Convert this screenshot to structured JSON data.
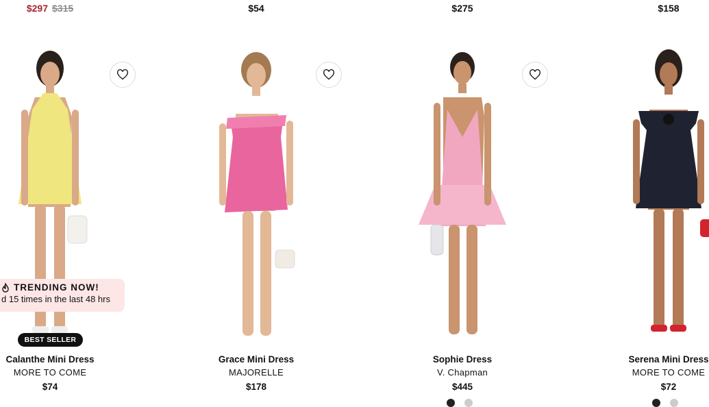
{
  "previous_row": {
    "prices": [
      {
        "sale": "$297",
        "original": "$315"
      },
      {
        "price": "$54"
      },
      {
        "price": "$275"
      },
      {
        "price": "$158"
      }
    ]
  },
  "products": [
    {
      "name": "Calanthe Mini Dress",
      "brand": "MORE TO COME",
      "price": "$74",
      "dress_color": "#f1ea8a"
    },
    {
      "name": "Grace Mini Dress",
      "brand": "MAJORELLE",
      "price": "$178",
      "dress_color": "#e9659e"
    },
    {
      "name": "Sophie Dress",
      "brand": "V. Chapman",
      "price": "$445",
      "dress_color": "#f2a7c0"
    },
    {
      "name": "Serena Mini Dress",
      "brand": "MORE TO COME",
      "price": "$72",
      "dress_color": "#1f2230"
    }
  ],
  "trending": {
    "title": "TRENDING NOW!",
    "subtitle": "d 15 times in the last 48 hrs"
  },
  "badge": {
    "label": "BEST SELLER"
  },
  "colors": {
    "sale": "#a3262d",
    "trending_bg": "#fde6e6"
  }
}
